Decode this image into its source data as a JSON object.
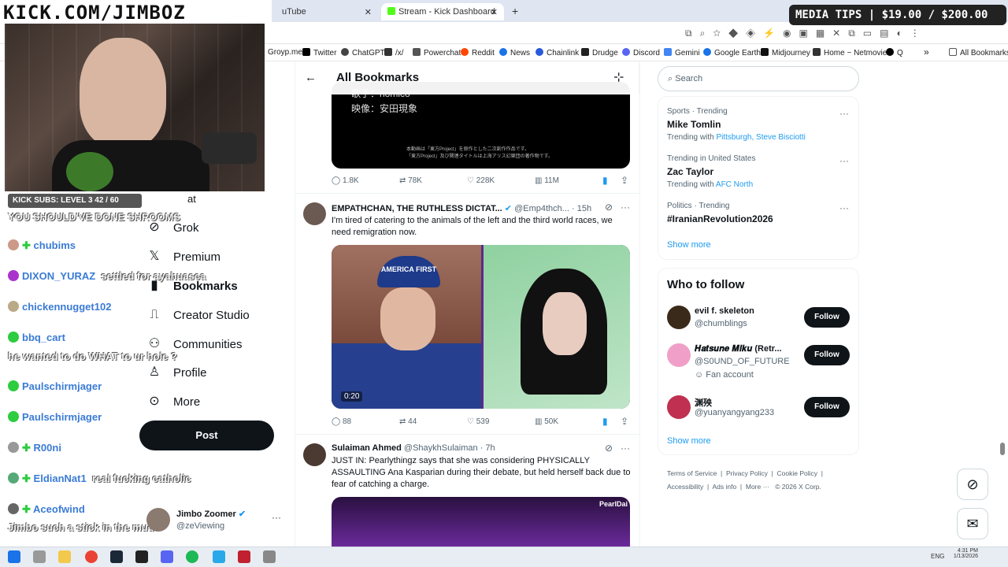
{
  "overlay": {
    "kick_url": "KICK.COM/JIMBOZ",
    "media_tips": "MEDIA TIPS | $19.00 / $200.00",
    "subs_goal": "KICK SUBS: LEVEL 3 42 / 60",
    "chat": [
      {
        "name": "",
        "msg": "YOU SHOULD'VE DONE SHROOMS"
      },
      {
        "name": "chubims",
        "msg": ""
      },
      {
        "name": "DIXON_YURAZ",
        "msg": "settled for ayahuasca"
      },
      {
        "name": "chickennugget102",
        "msg": ""
      },
      {
        "name": "bbq_cart",
        "msg": ""
      },
      {
        "name": "",
        "msg": "he wanted to do WHAT to ur hole ?"
      },
      {
        "name": "Paulschirmjager",
        "msg": ""
      },
      {
        "name": "Paulschirmjager",
        "msg": ""
      },
      {
        "name": "R00ni",
        "msg": ""
      },
      {
        "name": "EldianNat1",
        "msg": "real fucking catholic"
      },
      {
        "name": "Aceofwind",
        "msg": ""
      },
      {
        "name": "",
        "msg": "Jimbo such a stick in the mud"
      }
    ]
  },
  "browser": {
    "tabs": [
      "uTube",
      "Stream - Kick Dashboard",
      "+"
    ],
    "bookmarks": [
      "Groyp.me",
      "Twitter",
      "ChatGPT",
      "/x/",
      "Powerchat",
      "Reddit",
      "News",
      "Chainlink",
      "Drudge",
      "Discord",
      "Gemini",
      "Google Earth",
      "Midjourney",
      "Home ~ Netmovies",
      "Q",
      "»",
      "All Bookmarks"
    ]
  },
  "nav": {
    "partial_top": "at",
    "items": [
      {
        "label": "Grok",
        "icon": "grok-icon"
      },
      {
        "label": "Premium",
        "icon": "x-logo-icon"
      },
      {
        "label": "Bookmarks",
        "icon": "bookmark-icon"
      },
      {
        "label": "Creator Studio",
        "icon": "creator-studio-icon"
      },
      {
        "label": "Communities",
        "icon": "communities-icon"
      },
      {
        "label": "Profile",
        "icon": "profile-icon"
      },
      {
        "label": "More",
        "icon": "more-circle-icon"
      }
    ],
    "post_label": "Post",
    "account": {
      "name": "Jimbo Zoomer",
      "handle": "@zeViewing"
    }
  },
  "feed": {
    "title": "All Bookmarks",
    "video_caption": [
      "歌手：nomico",
      "映像：安田現象",
      "本動画は「東方Project」を原作とした二次創作作品です。",
      "「東方Project」及び関連タイトルは上海アリス幻樂団の著作物です。"
    ],
    "tweet0_actions": {
      "replies": "1.8K",
      "reposts": "78K",
      "likes": "228K",
      "views": "11M"
    },
    "tweet1": {
      "name": "EMPATHCHAN, THE RUTHLESS DICTAT...",
      "handle": "@Emp4thch...",
      "time": "· 15h",
      "text": "I'm tired of catering to the animals of the left and the third world races, we need remigration now.",
      "video_time": "0:20",
      "cap_text": "AMERICA FIRST",
      "actions": {
        "replies": "88",
        "reposts": "44",
        "likes": "539",
        "views": "50K"
      }
    },
    "tweet2": {
      "name": "Sulaiman Ahmed",
      "handle": "@ShaykhSulaiman",
      "time": "· 7h",
      "text": "JUST IN: Pearlythingz says that she was considering PHYSICALLY ASSAULTING Ana Kasparian during their debate, but held herself back due to fear of catching a charge.",
      "media_label": "PearlDai"
    }
  },
  "sidebar": {
    "search_placeholder": "Search",
    "trends": [
      {
        "context": "Sports · Trending",
        "name": "Mike Tomlin",
        "with_label": "Trending with",
        "with": "Pittsburgh, Steve Bisciotti"
      },
      {
        "context": "Trending in United States",
        "name": "Zac Taylor",
        "with_label": "Trending with",
        "with": "AFC North"
      },
      {
        "context": "Politics · Trending",
        "name": "#IranianRevolution2026",
        "with_label": "",
        "with": ""
      }
    ],
    "show_more": "Show more",
    "who_to_follow": "Who to follow",
    "follows": [
      {
        "name": "evil f. skeleton",
        "handle": "@chumblings",
        "extra": "",
        "button": "Follow"
      },
      {
        "name": "𝑯𝒂𝒕𝒔𝒖𝒏𝒆 𝑴𝒊𝒌𝒖 (Retr...",
        "handle": "@S0UND_OF_FUTURE",
        "extra": "Fan account",
        "button": "Follow"
      },
      {
        "name": "渊殃",
        "handle": "@yuanyangyang233",
        "extra": "",
        "button": "Follow"
      }
    ],
    "footer": [
      "Terms of Service",
      "Privacy Policy",
      "Cookie Policy",
      "Accessibility",
      "Ads info",
      "More ···",
      "© 2026 X Corp."
    ]
  },
  "taskbar": {
    "lang": "ENG",
    "time": "4:31 PM",
    "date": "1/13/2026"
  },
  "colors": {
    "accent": "#1d9bf0",
    "dark": "#0f1419",
    "bookmark_blue": "#1d9bf0"
  }
}
